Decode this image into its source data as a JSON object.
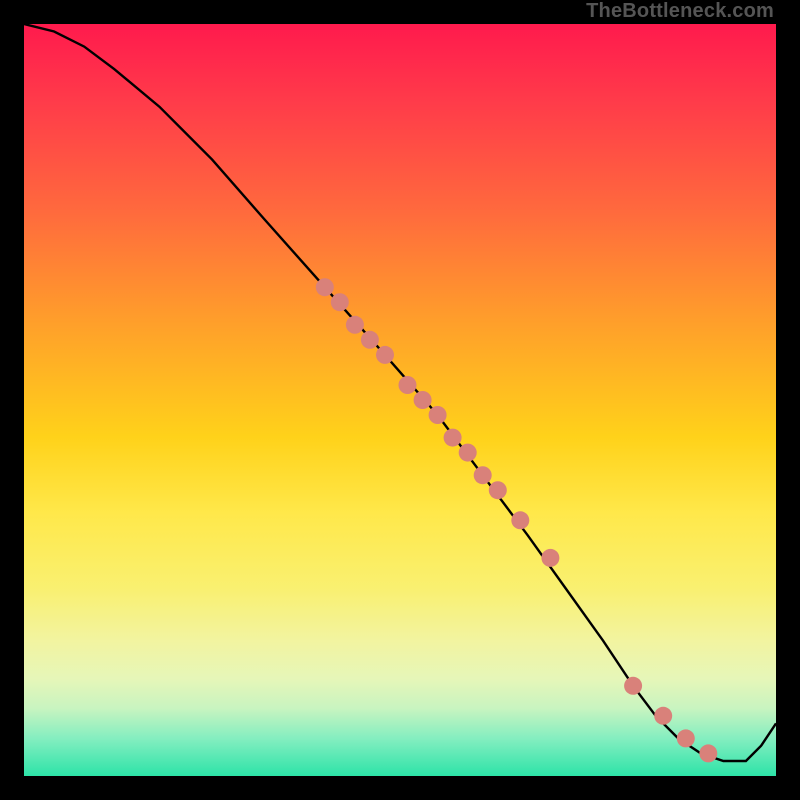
{
  "watermark": "TheBottleneck.com",
  "chart_data": {
    "type": "line",
    "title": "",
    "xlabel": "",
    "ylabel": "",
    "xlim": [
      0,
      100
    ],
    "ylim": [
      0,
      100
    ],
    "series": [
      {
        "name": "bottleneck-curve",
        "x": [
          0,
          4,
          8,
          12,
          18,
          25,
          32,
          40,
          48,
          55,
          61,
          67,
          72,
          77,
          81,
          84,
          87,
          90,
          93,
          96,
          98,
          100
        ],
        "values": [
          100,
          99,
          97,
          94,
          89,
          82,
          74,
          65,
          56,
          48,
          40,
          32,
          25,
          18,
          12,
          8,
          5,
          3,
          2,
          2,
          4,
          7
        ]
      }
    ],
    "markers": {
      "name": "highlighted-points",
      "x": [
        40,
        42,
        44,
        46,
        48,
        51,
        53,
        55,
        57,
        59,
        61,
        63,
        66,
        70,
        81,
        85,
        88,
        91
      ],
      "values": [
        65,
        63,
        60,
        58,
        56,
        52,
        50,
        48,
        45,
        43,
        40,
        38,
        34,
        29,
        12,
        8,
        5,
        3
      ],
      "color": "#d9817a",
      "radius": 9
    },
    "colors": {
      "curve": "#000000",
      "gradient_top": "#ff1a4d",
      "gradient_bottom": "#2de3a8"
    }
  }
}
